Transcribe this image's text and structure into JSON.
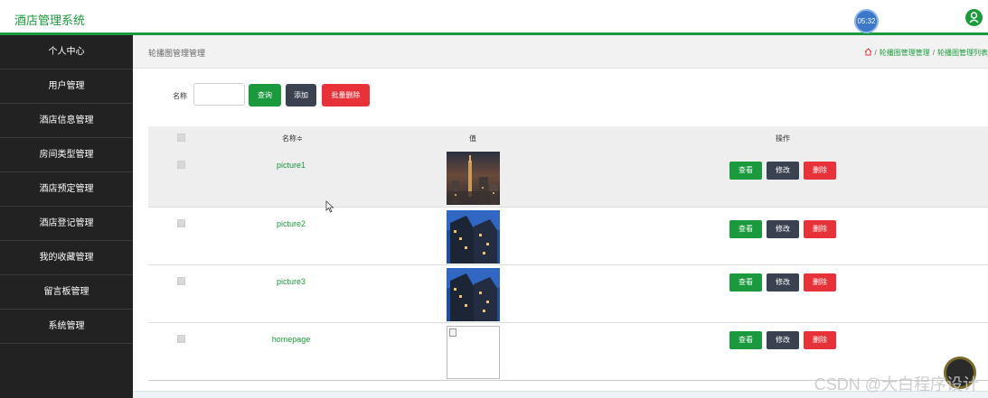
{
  "header": {
    "app_title": "酒店管理系统",
    "clock": "05:32"
  },
  "sidebar": {
    "items": [
      {
        "label": "个人中心"
      },
      {
        "label": "用户管理"
      },
      {
        "label": "酒店信息管理"
      },
      {
        "label": "房间类型管理"
      },
      {
        "label": "酒店预定管理"
      },
      {
        "label": "酒店登记管理"
      },
      {
        "label": "我的收藏管理"
      },
      {
        "label": "留言板管理"
      },
      {
        "label": "系统管理"
      }
    ]
  },
  "page": {
    "title": "轮播图管理管理",
    "breadcrumb": [
      "轮播图管理管理",
      "轮播图管理列表"
    ]
  },
  "filter": {
    "label": "名称",
    "input_value": "",
    "query_label": "查询",
    "add_label": "添加",
    "batch_delete_label": "批量删除"
  },
  "table": {
    "headers": {
      "name": "名称≑",
      "value": "值",
      "actions": "操作"
    },
    "rows": [
      {
        "name": "picture1",
        "image": "city-night"
      },
      {
        "name": "picture2",
        "image": "building-blue"
      },
      {
        "name": "picture3",
        "image": "building-blue"
      },
      {
        "name": "homepage",
        "image": "broken"
      }
    ],
    "actions": {
      "view": "查看",
      "edit": "修改",
      "delete": "删除"
    }
  },
  "watermark": "CSDN @大白程序设计",
  "colors": {
    "brand_green": "#1a9a3c",
    "sidebar_bg": "#222222",
    "dark_button": "#3a4150",
    "danger_red": "#e8323a"
  }
}
